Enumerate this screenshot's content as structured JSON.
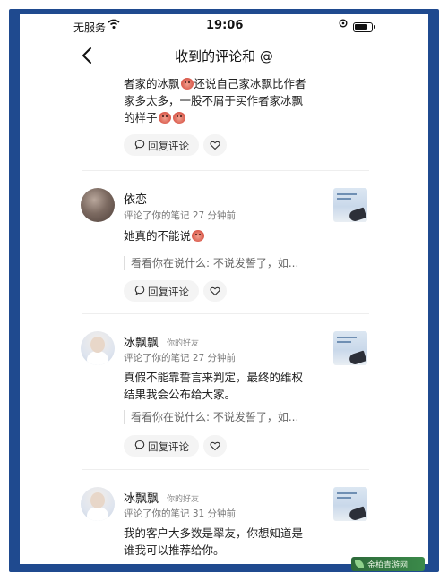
{
  "status_bar": {
    "carrier": "无服务",
    "wifi_icon": "wifi-icon",
    "time": "19:06",
    "location_icon": "location-icon",
    "battery_level": 0.8
  },
  "header": {
    "back_icon": "chevron-left-icon",
    "title": "收到的评论和 @"
  },
  "items": [
    {
      "text_line1": "者家的冰飘",
      "text_line1b": "还说自己家冰飘比作者",
      "text_line2": "家多太多，一股不屑于买作者家冰飘",
      "text_line3": "的样子",
      "reply_label": "回复评论"
    },
    {
      "name": "依恋",
      "meta": "评论了你的笔记  27 分钟前",
      "text": "她真的不能说",
      "quote": "看看你在说什么: 不说发誓了，如...",
      "reply_label": "回复评论"
    },
    {
      "name": "冰飘飘",
      "tag": "你的好友",
      "meta": "评论了你的笔记  27 分钟前",
      "text_line1": "真假不能靠誓言来判定，最终的维权",
      "text_line2": "结果我会公布给大家。",
      "quote": "看看你在说什么: 不说发誓了，如...",
      "reply_label": "回复评论"
    },
    {
      "name": "冰飘飘",
      "tag": "你的好友",
      "meta": "评论了你的笔记  31 分钟前",
      "text_line1": "我的客户大多数是翠友，你想知道是",
      "text_line2": "谁我可以推荐给你。"
    }
  ],
  "icons": {
    "reply": "comment-icon",
    "like": "heart-icon",
    "emoji": "devil-emoji-icon"
  },
  "watermark": "金柏青游网"
}
